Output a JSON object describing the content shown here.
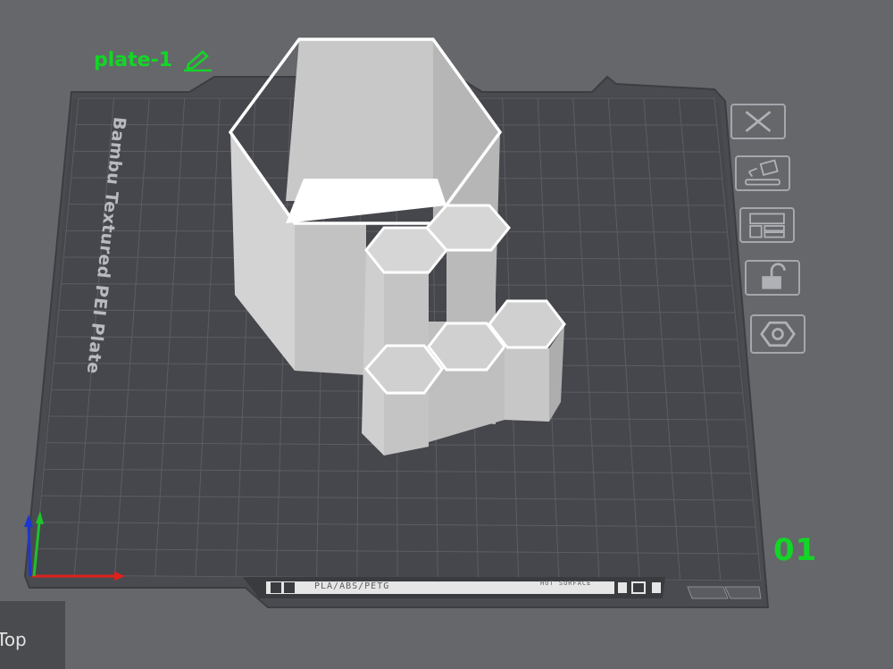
{
  "plate": {
    "label": "plate-1",
    "number": "01",
    "surface_name": "Bambu Textured PEI Plate",
    "filament_types": "PLA/ABS/PETG",
    "surface_note": "HOT SURFACE"
  },
  "view": {
    "tab_label": "Top"
  },
  "toolbar": {
    "items": [
      "close-icon",
      "auto-orient-icon",
      "arrange-icon",
      "unlock-icon",
      "hexnut-icon"
    ]
  },
  "colors": {
    "accent_green": "#12d626",
    "background": "#66676b",
    "plate_dark": "#47484d",
    "grid": "#5f6066",
    "model": "#c9c9c9",
    "model_outline": "#ffffff",
    "axis_x": "#e0201c",
    "axis_y": "#1ec22b",
    "axis_z": "#1c35d6"
  }
}
